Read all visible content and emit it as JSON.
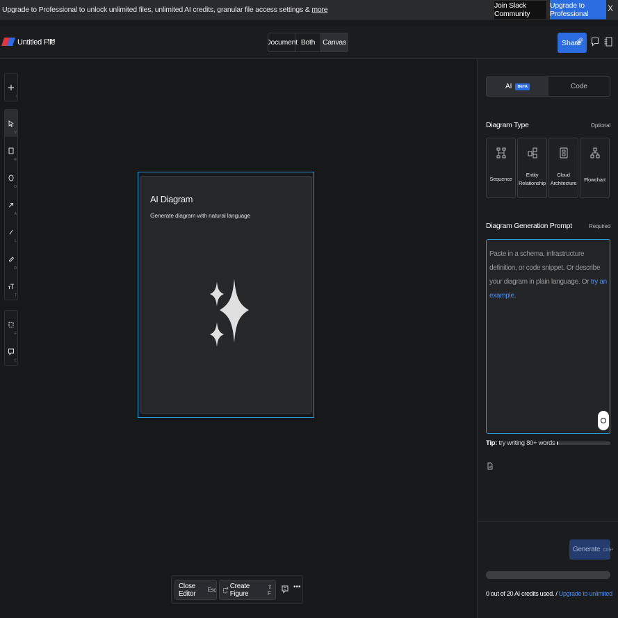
{
  "banner": {
    "text": "Upgrade to Professional to unlock unlimited files, unlimited AI credits, granular file access settings & ",
    "more_link": "more",
    "slack_label": "Join Slack Community",
    "upgrade_label": "Upgrade to Professional",
    "close_label": "X"
  },
  "header": {
    "file_name": "Untitled File",
    "more_label": "•••",
    "views": [
      "Document",
      "Both",
      "Canvas"
    ],
    "active_view": "Canvas",
    "share_label": "Share"
  },
  "toolbar": {
    "tools": [
      {
        "name": "add",
        "key": "/"
      },
      {
        "name": "select",
        "key": "V"
      },
      {
        "name": "rectangle",
        "key": "R"
      },
      {
        "name": "ellipse",
        "key": "O"
      },
      {
        "name": "arrow",
        "key": "A"
      },
      {
        "name": "line",
        "key": "L"
      },
      {
        "name": "pencil",
        "key": "D"
      },
      {
        "name": "text",
        "key": "T"
      },
      {
        "name": "frame",
        "key": "F"
      },
      {
        "name": "comment",
        "key": "C"
      }
    ]
  },
  "card": {
    "title": "AI Diagram",
    "subtitle": "Generate diagram with natural language"
  },
  "bottombar": {
    "close_label": "Close Editor",
    "close_key": "Esc",
    "create_label": "Create Figure",
    "create_key": "⇧ F",
    "more_label": "•••"
  },
  "panel": {
    "tab_ai": "AI",
    "beta_badge": "BETA",
    "tab_code": "Code",
    "diagram_type_title": "Diagram Type",
    "diagram_type_tag": "Optional",
    "types": [
      {
        "line1": "Sequence",
        "line2": ""
      },
      {
        "line1": "Entity",
        "line2": "Relationship"
      },
      {
        "line1": "Cloud",
        "line2": "Architecture"
      },
      {
        "line1": "Flowchart",
        "line2": ""
      }
    ],
    "prompt_title": "Diagram Generation Prompt",
    "prompt_tag": "Required",
    "prompt_placeholder": "Paste in a schema, infrastructure definition, or code snippet. Or describe your diagram in plain language. Or ",
    "prompt_example_link": "try an example",
    "prompt_placeholder_end": ".",
    "tip_label": "Tip:",
    "tip_text": " try writing 80+ words",
    "tip_progress": 0.02,
    "generate_label": "Generate",
    "generate_key": "Ctrl↵",
    "credits_progress": 0,
    "credits_text": "0 out of 20 AI credits used. / ",
    "credits_link": "Upgrade to unlimited"
  }
}
